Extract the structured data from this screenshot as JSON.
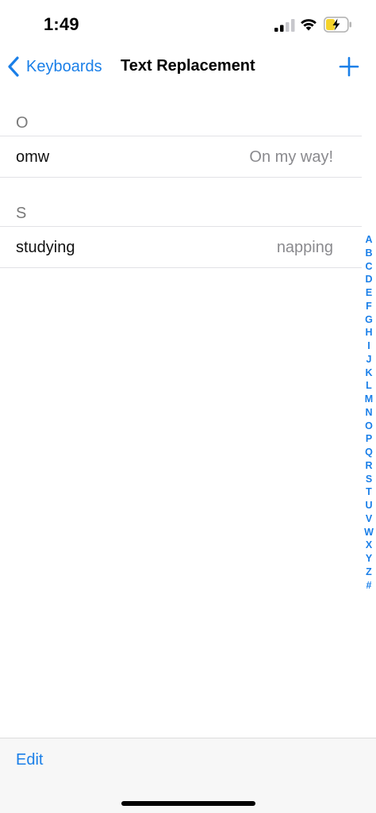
{
  "status": {
    "time": "1:49",
    "signal_icon": "cellular-signal-icon",
    "wifi_icon": "wifi-icon",
    "battery_icon": "battery-charging-icon"
  },
  "nav": {
    "back_label": "Keyboards",
    "title": "Text Replacement",
    "add_icon": "plus-icon"
  },
  "sections": [
    {
      "header": "O",
      "items": [
        {
          "shortcut": "omw",
          "phrase": "On my way!"
        }
      ]
    },
    {
      "header": "S",
      "items": [
        {
          "shortcut": "studying",
          "phrase": "napping"
        }
      ]
    }
  ],
  "index": [
    "A",
    "B",
    "C",
    "D",
    "E",
    "F",
    "G",
    "H",
    "I",
    "J",
    "K",
    "L",
    "M",
    "N",
    "O",
    "P",
    "Q",
    "R",
    "S",
    "T",
    "U",
    "V",
    "W",
    "X",
    "Y",
    "Z",
    "#"
  ],
  "toolbar": {
    "edit_label": "Edit"
  },
  "colors": {
    "accent": "#1a7fe8",
    "secondary_text": "#8a8a8e",
    "battery_fill": "#f5d32a"
  }
}
